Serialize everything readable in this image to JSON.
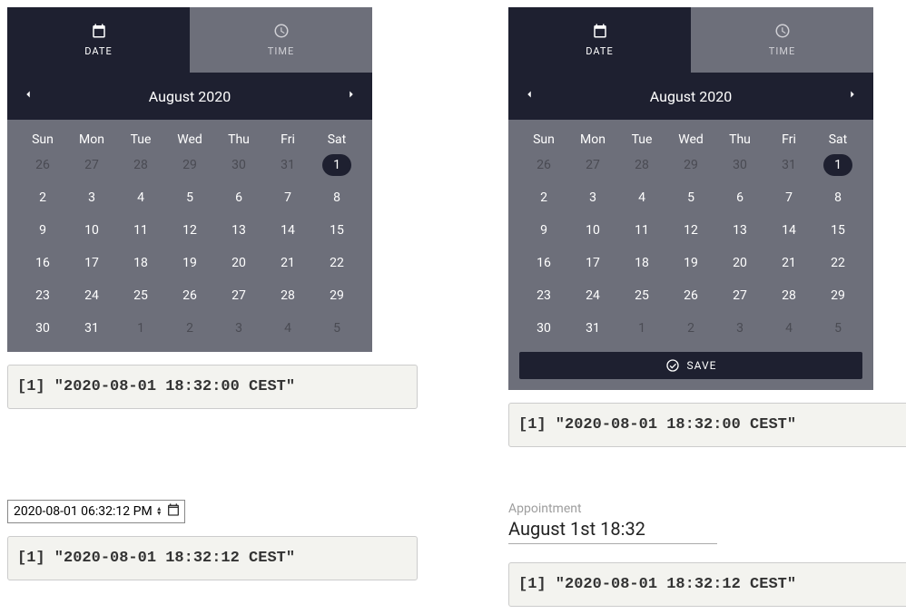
{
  "tabs": {
    "date": "DATE",
    "time": "TIME"
  },
  "nav_title": "August 2020",
  "weekdays": [
    "Sun",
    "Mon",
    "Tue",
    "Wed",
    "Thu",
    "Fri",
    "Sat"
  ],
  "prev_month_days": [
    26,
    27,
    28,
    29,
    30,
    31
  ],
  "days": [
    1,
    2,
    3,
    4,
    5,
    6,
    7,
    8,
    9,
    10,
    11,
    12,
    13,
    14,
    15,
    16,
    17,
    18,
    19,
    20,
    21,
    22,
    23,
    24,
    25,
    26,
    27,
    28,
    29,
    30,
    31
  ],
  "next_month_days": [
    1,
    2,
    3,
    4,
    5
  ],
  "selected_day": 1,
  "save_label": "SAVE",
  "output1": "[1] \"2020-08-01 18:32:00 CEST\"",
  "output2": "[1] \"2020-08-01 18:32:00 CEST\"",
  "native_value": "2020-08-01 06:32:12 PM",
  "output3": "[1] \"2020-08-01 18:32:12 CEST\"",
  "appointment_label": "Appointment",
  "appointment_value": "August 1st 18:32",
  "output4": "[1] \"2020-08-01 18:32:12 CEST\""
}
